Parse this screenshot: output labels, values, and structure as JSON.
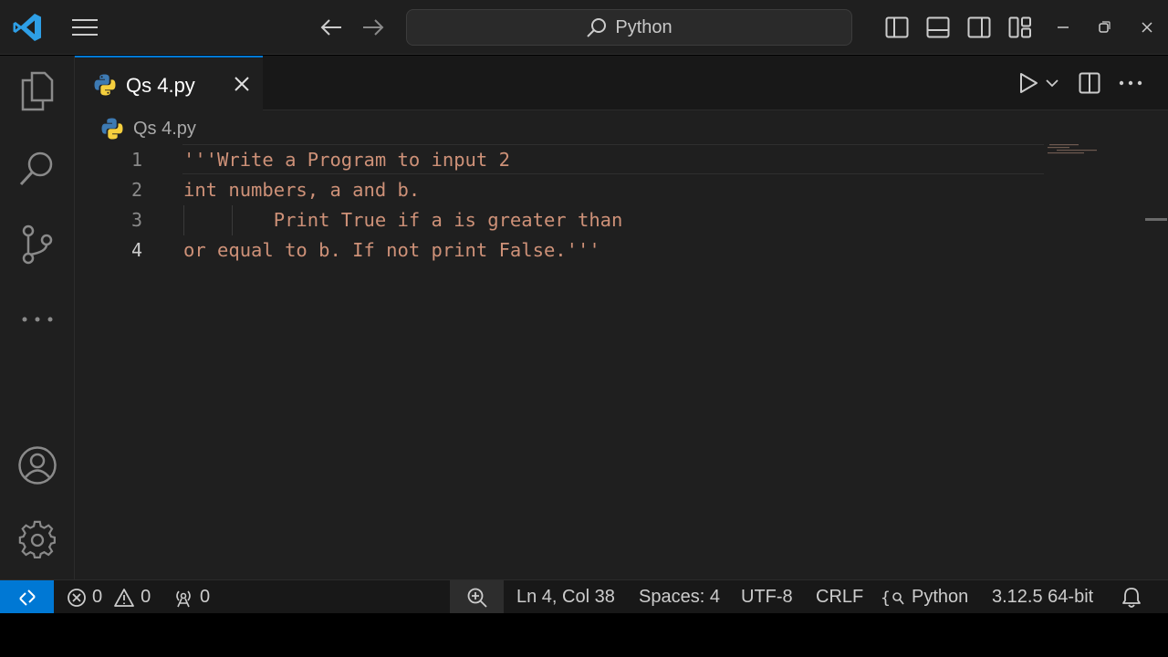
{
  "titlebar": {
    "search_text": "Python"
  },
  "tab": {
    "label": "Qs 4.py"
  },
  "breadcrumb": {
    "file": "Qs 4.py"
  },
  "code": {
    "lines": [
      {
        "num": "1",
        "text": "'''Write a Program to input 2"
      },
      {
        "num": "2",
        "text": "int numbers, a and b."
      },
      {
        "num": "3",
        "text": "        Print True if a is greater than"
      },
      {
        "num": "4",
        "text": "or equal to b. If not print False.'''"
      }
    ]
  },
  "statusbar": {
    "errors": "0",
    "warnings": "0",
    "ports": "0",
    "position": "Ln 4, Col 38",
    "spaces": "Spaces: 4",
    "encoding": "UTF-8",
    "eol": "CRLF",
    "language": "Python",
    "interpreter": "3.12.5 64-bit"
  },
  "colors": {
    "accent": "#0078d4",
    "string": "#ce9178",
    "background": "#1f1f1f"
  },
  "icons": [
    "vscode-logo-icon",
    "menu-icon",
    "arrow-left-icon",
    "arrow-right-icon",
    "search-icon",
    "layout-sidebar-left-icon",
    "layout-panel-icon",
    "layout-sidebar-right-icon",
    "customize-layout-icon",
    "minimize-icon",
    "restore-icon",
    "close-icon",
    "explorer-icon",
    "search-icon",
    "source-control-icon",
    "more-icon",
    "account-icon",
    "gear-icon",
    "python-icon",
    "run-icon",
    "chevron-down-icon",
    "split-editor-icon",
    "ellipsis-icon",
    "remote-icon",
    "error-icon",
    "warning-icon",
    "broadcast-icon",
    "zoom-icon",
    "braces-icon",
    "bell-icon"
  ]
}
